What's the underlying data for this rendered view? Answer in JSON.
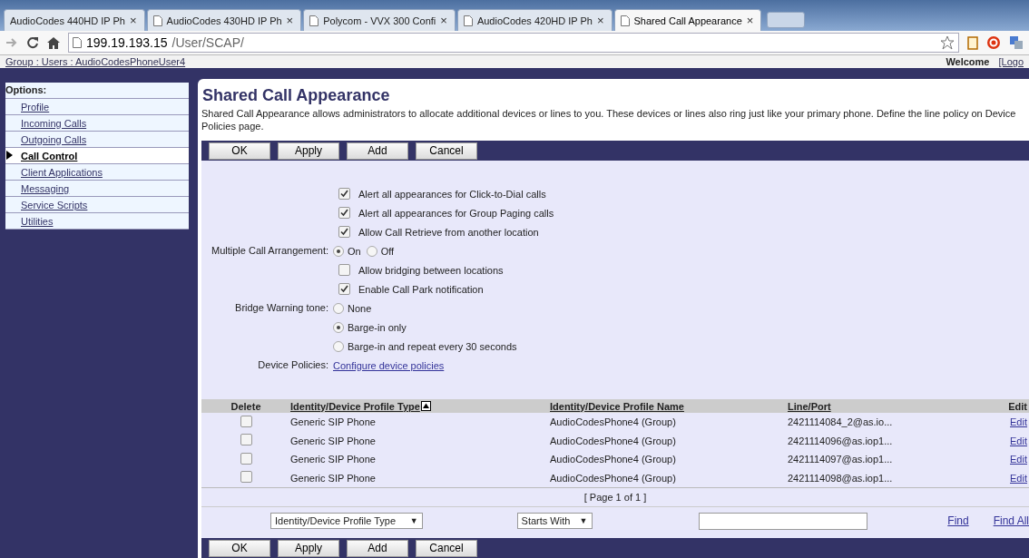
{
  "browser": {
    "tabs": [
      {
        "title": "AudioCodes 440HD IP Ph",
        "icon": false,
        "selected": false
      },
      {
        "title": "AudioCodes 430HD IP Ph",
        "icon": true,
        "selected": false
      },
      {
        "title": "Polycom - VVX 300 Confi",
        "icon": true,
        "selected": false
      },
      {
        "title": "AudioCodes 420HD IP Ph",
        "icon": true,
        "selected": false
      },
      {
        "title": "Shared Call Appearance",
        "icon": true,
        "selected": true
      }
    ],
    "close_glyph": "×",
    "url_host": "199.19.193.15",
    "url_path": "/User/SCAP/"
  },
  "header": {
    "breadcrumb": "Group : Users : AudioCodesPhoneUser4",
    "welcome": "Welcome",
    "logout": "[Logo"
  },
  "sidebar": {
    "title": "Options:",
    "items": [
      {
        "label": "Profile",
        "selected": false
      },
      {
        "label": "Incoming Calls",
        "selected": false
      },
      {
        "label": "Outgoing Calls",
        "selected": false
      },
      {
        "label": "Call Control",
        "selected": true
      },
      {
        "label": "Client Applications",
        "selected": false
      },
      {
        "label": "Messaging",
        "selected": false
      },
      {
        "label": "Service Scripts",
        "selected": false
      },
      {
        "label": "Utilities",
        "selected": false
      }
    ]
  },
  "page": {
    "title": "Shared Call Appearance",
    "description": "Shared Call Appearance allows administrators to allocate additional devices or lines to you. These devices or lines also ring just like your primary phone. Define the line policy on Device Policies page."
  },
  "top_buttons": [
    "OK",
    "Apply",
    "Add",
    "Cancel"
  ],
  "form": [
    {
      "kind": "checkbox",
      "label": "Alert all appearances for Click-to-Dial calls",
      "checked": true
    },
    {
      "kind": "checkbox",
      "label": "Alert all appearances for Group Paging calls",
      "checked": true
    },
    {
      "kind": "checkbox",
      "label": "Allow Call Retrieve from another location",
      "checked": true
    },
    {
      "kind": "radio-inline",
      "label": "Multiple Call Arrangement:",
      "options": [
        {
          "label": "On",
          "selected": true
        },
        {
          "label": "Off",
          "selected": false
        }
      ]
    },
    {
      "kind": "checkbox",
      "label": "Allow bridging between locations",
      "checked": false
    },
    {
      "kind": "checkbox",
      "label": "Enable Call Park notification",
      "checked": true
    },
    {
      "kind": "radio-stack",
      "label": "Bridge Warning tone:",
      "options": [
        {
          "label": "None",
          "selected": false
        },
        {
          "label": "Barge-in only",
          "selected": true
        },
        {
          "label": "Barge-in and repeat every 30 seconds",
          "selected": false
        }
      ]
    },
    {
      "kind": "link",
      "label": "Device Policies:",
      "link": "Configure device policies"
    }
  ],
  "table": {
    "columns": [
      {
        "label": "Delete",
        "sortable": false,
        "sorted": false
      },
      {
        "label": "Identity/Device Profile Type",
        "sortable": true,
        "sorted": true
      },
      {
        "label": "Identity/Device Profile Name",
        "sortable": true,
        "sorted": false
      },
      {
        "label": "Line/Port",
        "sortable": true,
        "sorted": false
      },
      {
        "label": "Edit",
        "sortable": false,
        "sorted": false
      }
    ],
    "rows": [
      {
        "checked": false,
        "type": "Generic SIP Phone",
        "name": "AudioCodesPhone4 (Group)",
        "line": "2421114084_2@as.io...",
        "edit": "Edit"
      },
      {
        "checked": false,
        "type": "Generic SIP Phone",
        "name": "AudioCodesPhone4 (Group)",
        "line": "2421114096@as.iop1...",
        "edit": "Edit"
      },
      {
        "checked": false,
        "type": "Generic SIP Phone",
        "name": "AudioCodesPhone4 (Group)",
        "line": "2421114097@as.iop1...",
        "edit": "Edit"
      },
      {
        "checked": false,
        "type": "Generic SIP Phone",
        "name": "AudioCodesPhone4 (Group)",
        "line": "2421114098@as.iop1...",
        "edit": "Edit"
      }
    ],
    "pager": "[ Page 1 of 1 ]"
  },
  "bottom_buttons": [
    "OK",
    "Apply",
    "Add",
    "Cancel"
  ],
  "search": {
    "field": "Identity/Device Profile Type",
    "mode": "Starts With",
    "dropdown_glyph": "▼",
    "find": "Find",
    "find_all": "Find All"
  }
}
